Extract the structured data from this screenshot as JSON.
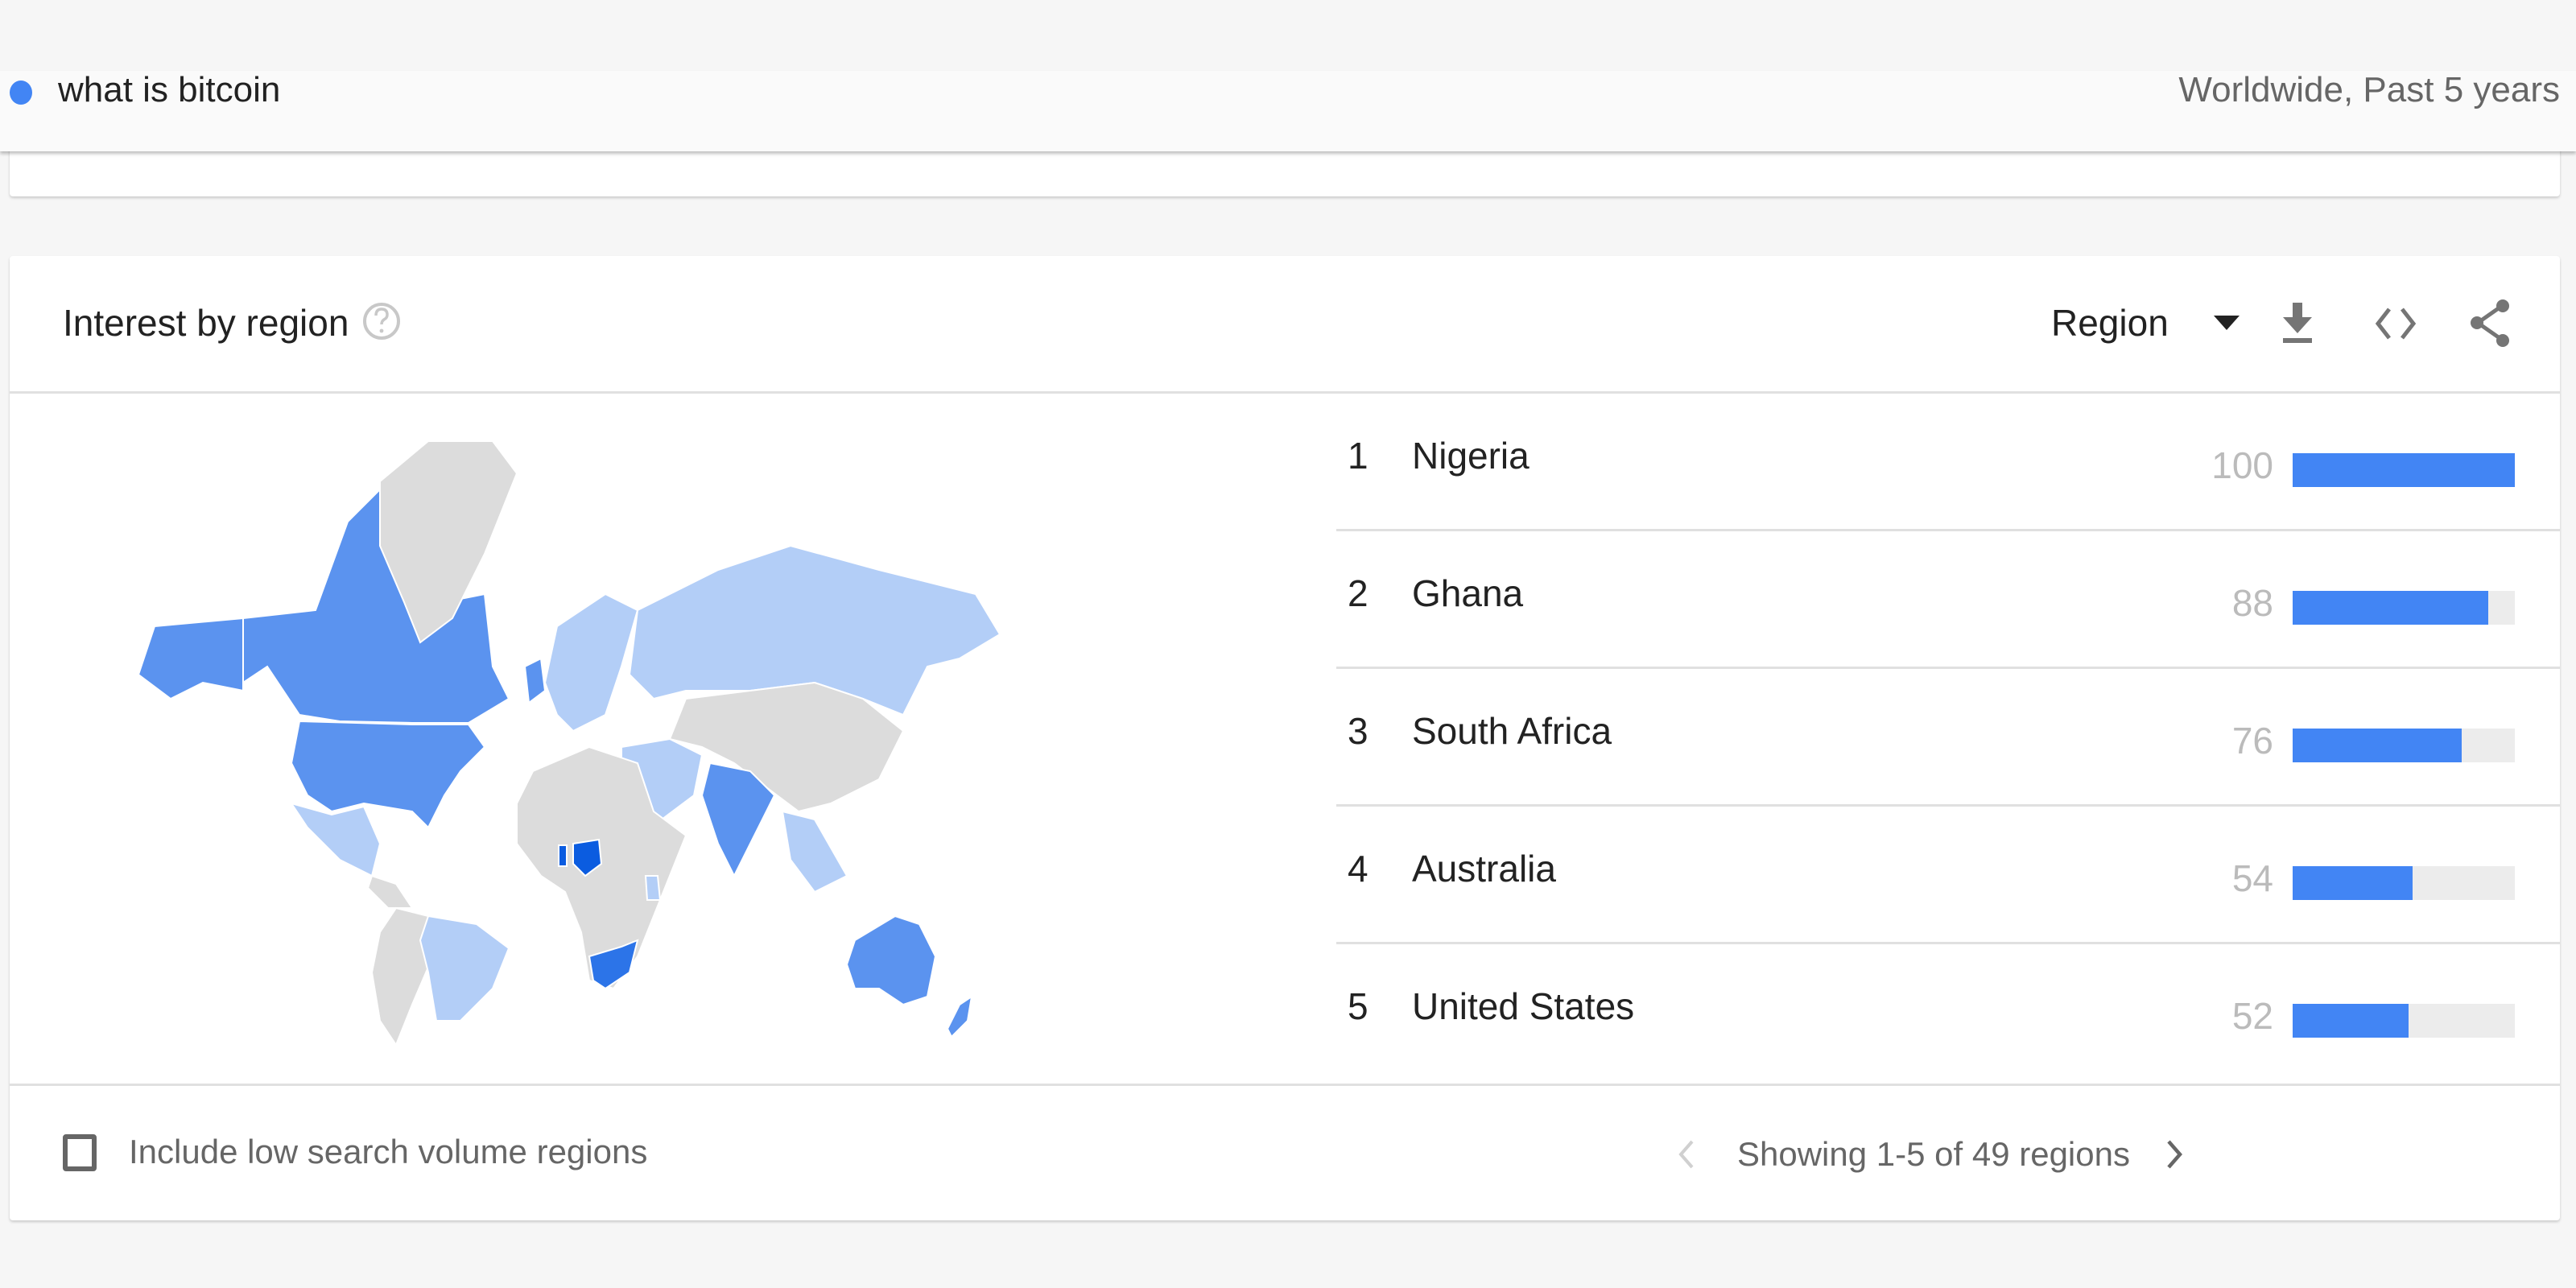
{
  "search_term": {
    "label": "what is bitcoin",
    "color": "#4285f4",
    "scope": "Worldwide, Past 5 years"
  },
  "card": {
    "title": "Interest by region",
    "help_icon": "help-circle-icon",
    "resolution_select": {
      "value": "Region"
    },
    "actions": [
      {
        "name": "download-icon",
        "label": "Download CSV"
      },
      {
        "name": "embed-icon",
        "label": "Embed"
      },
      {
        "name": "share-icon",
        "label": "Share"
      }
    ]
  },
  "chart_data": {
    "type": "table",
    "title": "Interest by region",
    "columns": [
      "rank",
      "region",
      "value"
    ],
    "max": 100,
    "rows": [
      {
        "rank": "1",
        "region": "Nigeria",
        "value": 100
      },
      {
        "rank": "2",
        "region": "Ghana",
        "value": 88
      },
      {
        "rank": "3",
        "region": "South Africa",
        "value": 76
      },
      {
        "rank": "4",
        "region": "Australia",
        "value": 54
      },
      {
        "rank": "5",
        "region": "United States",
        "value": 52
      }
    ],
    "bar_color": "#4285f4",
    "track_color": "#ececec"
  },
  "map": {
    "type": "choropleth",
    "scale_colors": {
      "high": "#0b5ce0",
      "mid_high": "#2c74e8",
      "mid": "#5b93ef",
      "low": "#b3cef7",
      "none": "#dcdcdc"
    },
    "regions": [
      {
        "name": "Nigeria",
        "level": "high"
      },
      {
        "name": "Ghana",
        "level": "high"
      },
      {
        "name": "South Africa",
        "level": "mid_high"
      },
      {
        "name": "Australia",
        "level": "mid"
      },
      {
        "name": "United States",
        "level": "mid"
      },
      {
        "name": "Canada",
        "level": "mid"
      },
      {
        "name": "India",
        "level": "mid"
      },
      {
        "name": "Russia",
        "level": "low"
      },
      {
        "name": "Brazil",
        "level": "low"
      },
      {
        "name": "Mexico",
        "level": "low"
      }
    ]
  },
  "footer": {
    "checkbox_label": "Include low search volume regions",
    "checkbox_checked": false,
    "pagination_text": "Showing 1-5 of 49 regions"
  }
}
